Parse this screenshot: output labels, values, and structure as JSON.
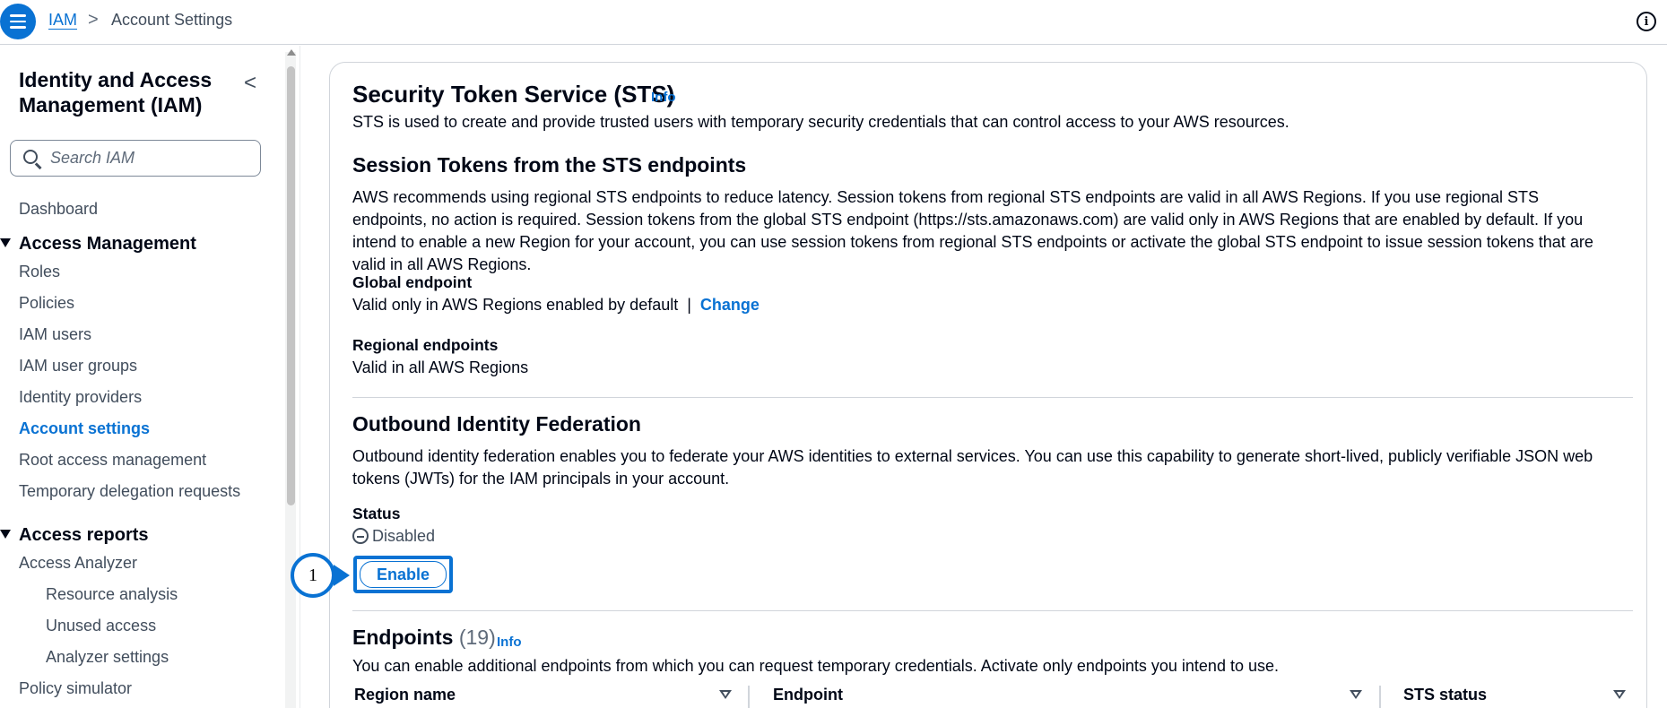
{
  "header": {
    "breadcrumb_root": "IAM",
    "breadcrumb_separator": ">",
    "breadcrumb_current": "Account Settings",
    "info_icon_glyph": "i"
  },
  "sidebar": {
    "title": "Identity and Access Management (IAM)",
    "collapse_glyph": "<",
    "search_placeholder": "Search IAM",
    "dashboard": "Dashboard",
    "access_management": {
      "label": "Access Management",
      "items": [
        "Roles",
        "Policies",
        "IAM users",
        "IAM user groups",
        "Identity providers",
        "Account settings",
        "Root access management",
        "Temporary delegation requests"
      ],
      "active": "Account settings"
    },
    "access_reports": {
      "label": "Access reports",
      "items": [
        "Access Analyzer"
      ],
      "subitems": [
        "Resource analysis",
        "Unused access",
        "Analyzer settings"
      ],
      "after": [
        "Policy simulator"
      ]
    }
  },
  "main": {
    "sts": {
      "title": "Security Token Service (STS)",
      "info": "Info",
      "description": "STS is used to create and provide trusted users with temporary security credentials that can control access to your AWS resources."
    },
    "session_tokens": {
      "title": "Session Tokens from the STS endpoints",
      "description": "AWS recommends using regional STS endpoints to reduce latency. Session tokens from regional STS endpoints are valid in all AWS Regions. If you use regional STS endpoints, no action is required. Session tokens from the global STS endpoint (https://sts.amazonaws.com) are valid only in AWS Regions that are enabled by default. If you intend to enable a new Region for your account, you can use session tokens from regional STS endpoints or activate the global STS endpoint to issue session tokens that are valid in all AWS Regions.",
      "global_label": "Global endpoint",
      "global_value": "Valid only in AWS Regions enabled by default",
      "separator": "|",
      "change_link": "Change",
      "regional_label": "Regional endpoints",
      "regional_value": "Valid in all AWS Regions"
    },
    "outbound": {
      "title": "Outbound Identity Federation",
      "description": "Outbound identity federation enables you to federate your AWS identities to external services. You can use this capability to generate short-lived, publicly verifiable JSON web tokens (JWTs) for the IAM principals in your account.",
      "status_label": "Status",
      "status_value": "Disabled",
      "enable_button": "Enable",
      "callout_number": "1"
    },
    "endpoints": {
      "title": "Endpoints",
      "count": "(19)",
      "info": "Info",
      "description": "You can enable additional endpoints from which you can request temporary credentials. Activate only endpoints you intend to use.",
      "columns": [
        "Region name",
        "Endpoint",
        "STS status"
      ]
    }
  },
  "colors": {
    "accent": "#0972d3",
    "text": "#000716",
    "muted": "#414d5c",
    "border": "#d1d5db"
  }
}
